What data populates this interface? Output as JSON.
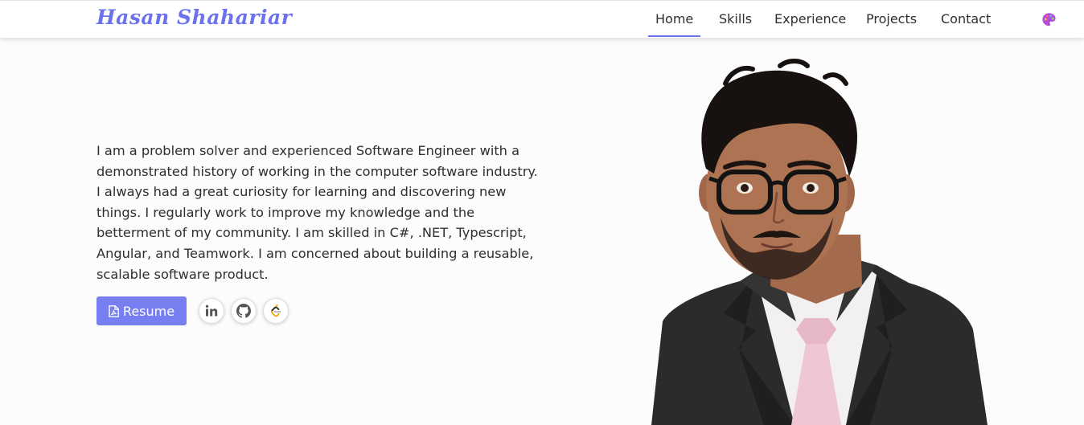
{
  "brand": {
    "name": "Hasan Shahariar",
    "color": "#6c72ee"
  },
  "nav": {
    "items": [
      {
        "label": "Home",
        "active": true
      },
      {
        "label": "Skills",
        "active": false
      },
      {
        "label": "Experience",
        "active": false
      },
      {
        "label": "Projects",
        "active": false
      },
      {
        "label": "Contact",
        "active": false
      }
    ],
    "theme_icon": "palette-icon"
  },
  "intro": {
    "lines": [
      "I am a problem solver and experienced Software Engineer with a",
      "demonstrated history of working in the computer software industry.",
      "I always had a great curiosity for learning and discovering new",
      "things. I regularly work to improve my knowledge and the",
      "betterment of my community. I am skilled in C#, .NET, Typescript,",
      "Angular, and Teamwork. I am concerned about building a reusable,",
      "scalable software product."
    ]
  },
  "actions": {
    "resume_label": "Resume",
    "resume_icon": "pdf-file-icon",
    "accent_color": "#767ef0",
    "social": [
      {
        "name": "linkedin",
        "icon": "linkedin-icon"
      },
      {
        "name": "github",
        "icon": "github-icon"
      },
      {
        "name": "leetcode",
        "icon": "leetcode-icon"
      }
    ]
  },
  "portrait": {
    "subject": "profile-photo"
  }
}
